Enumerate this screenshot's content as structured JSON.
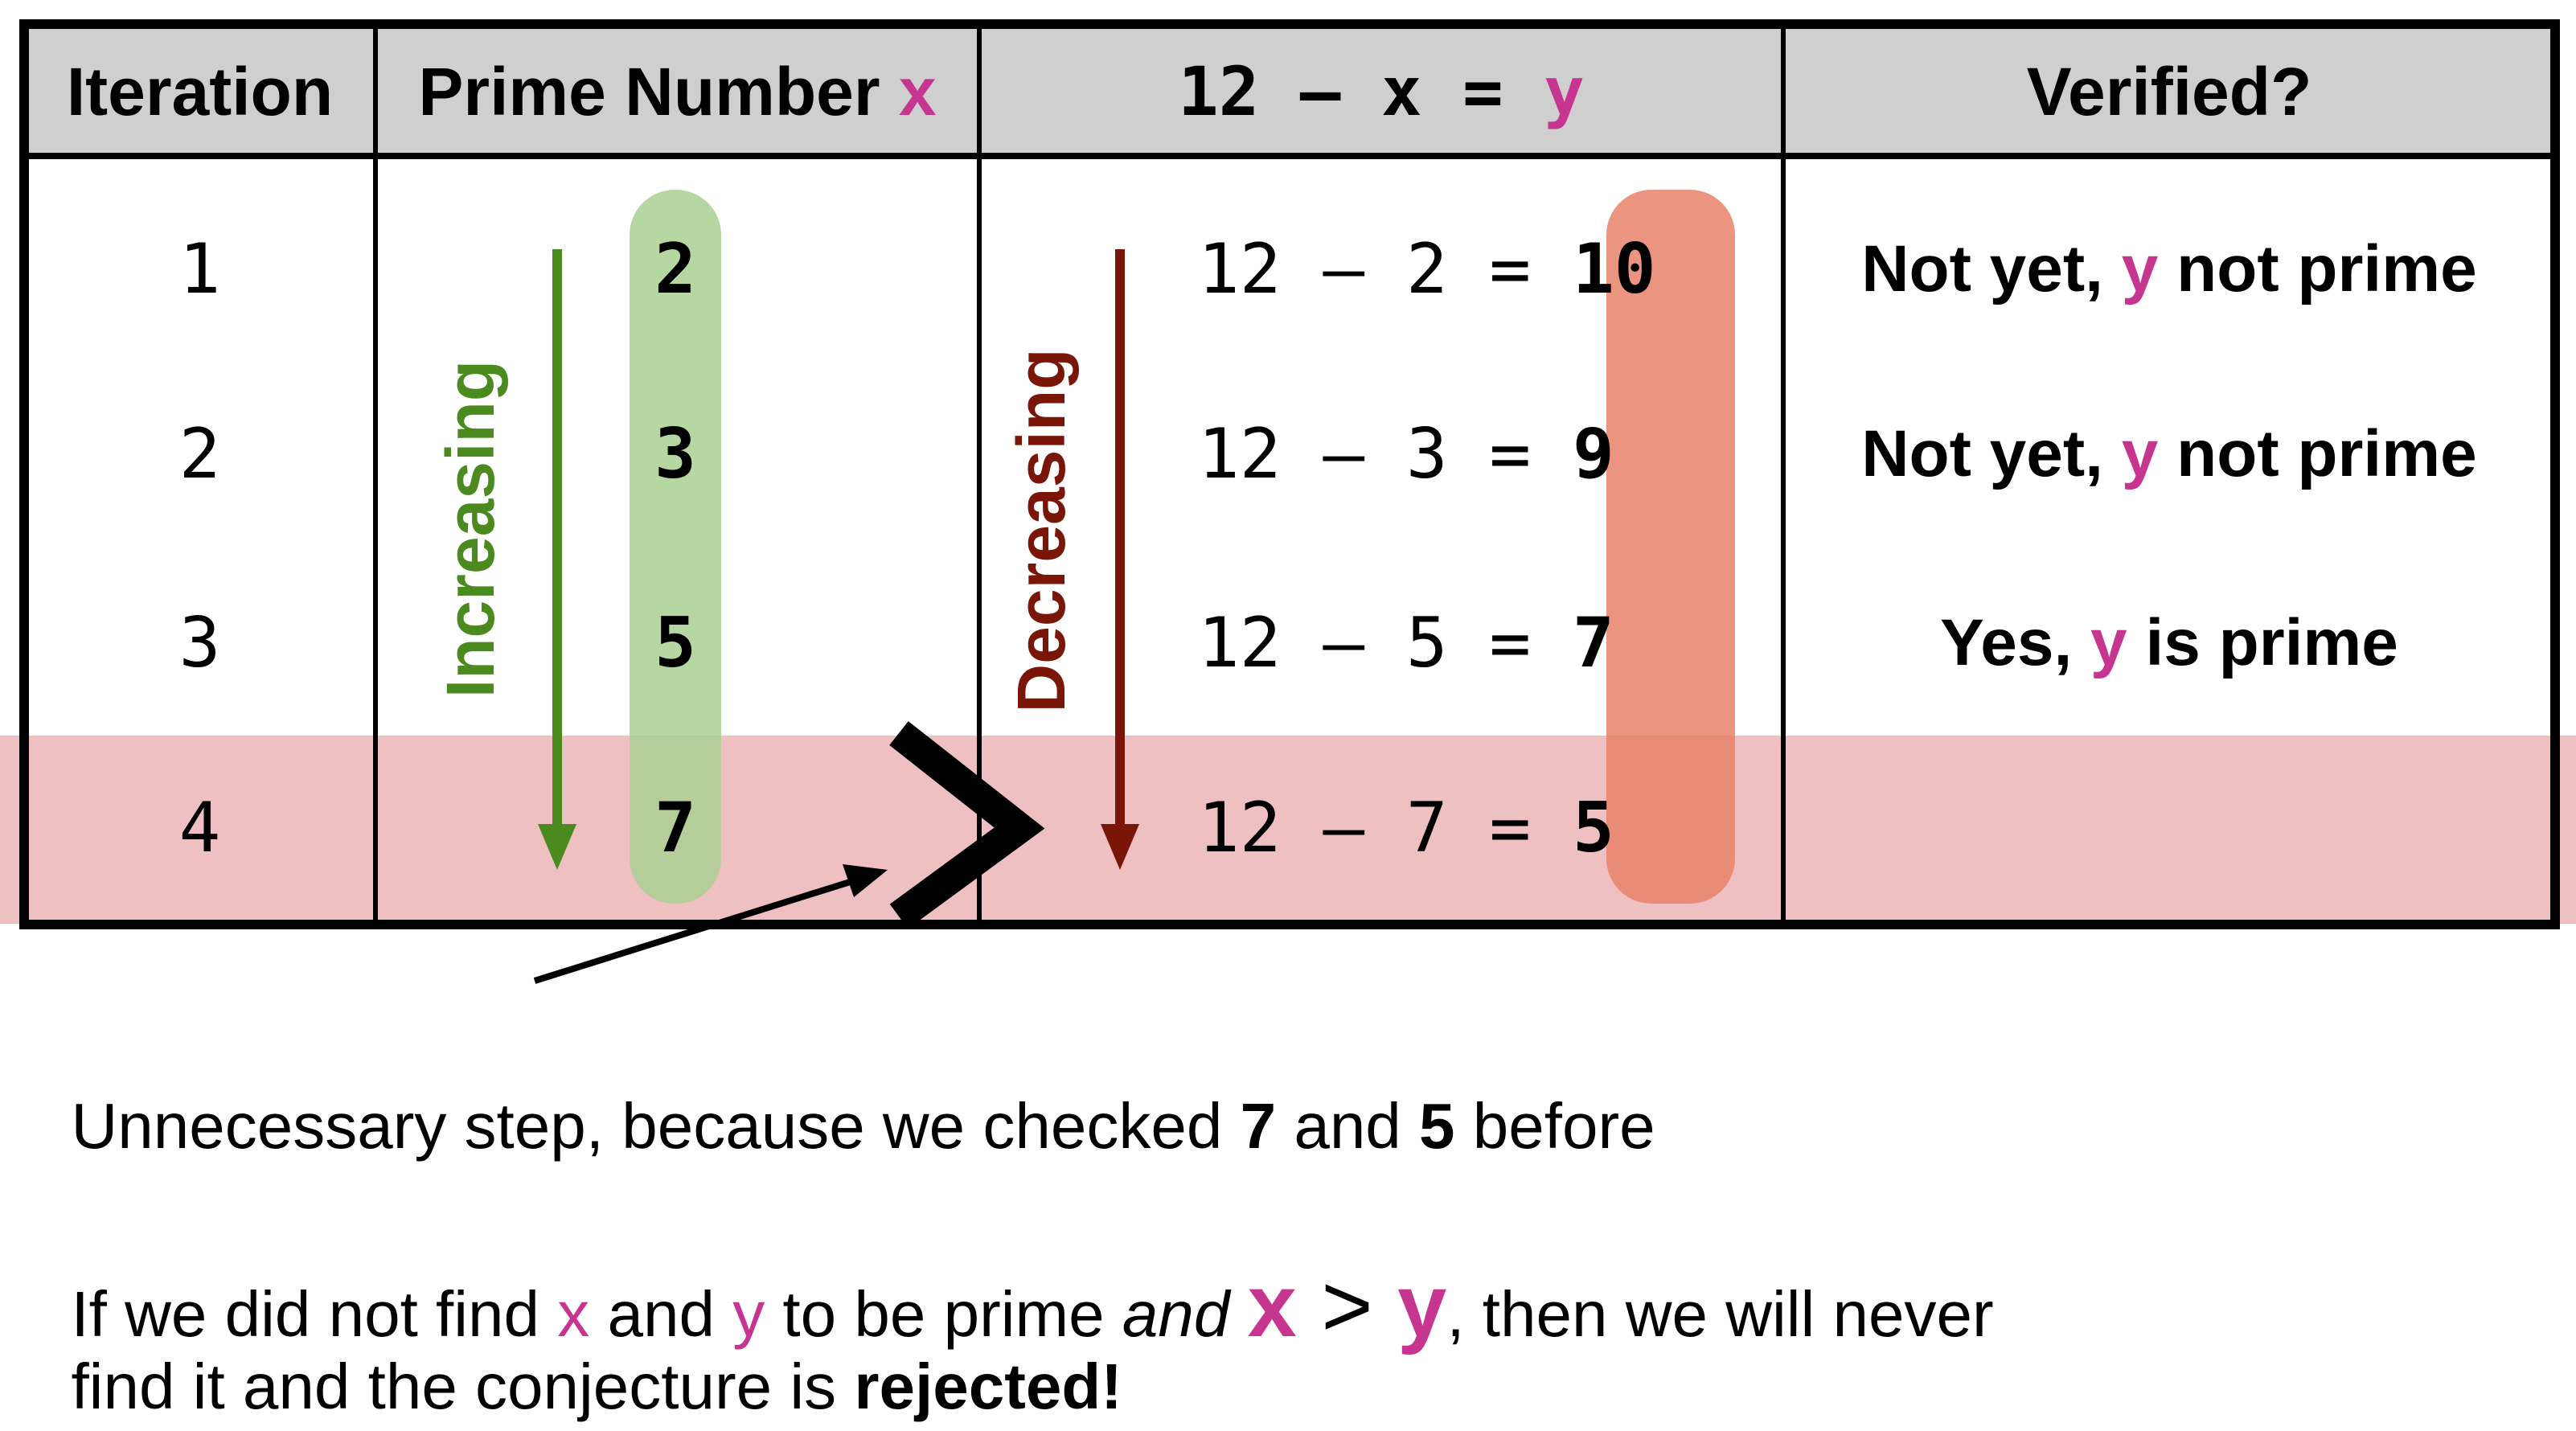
{
  "table": {
    "headers": {
      "iteration": "Iteration",
      "prime_prefix": "Prime Number ",
      "prime_var": "x",
      "eq_prefix": "12 – x = ",
      "eq_var": "y",
      "verified": "Verified?"
    },
    "rows": [
      {
        "iteration": "1",
        "x": "2",
        "eq": "12 – 2 = ",
        "y": "10",
        "verified_pre": "Not yet, ",
        "verified_var": "y",
        "verified_post": " not prime"
      },
      {
        "iteration": "2",
        "x": "3",
        "eq": "12 – 3 = ",
        "y": "9",
        "verified_pre": "Not yet, ",
        "verified_var": "y",
        "verified_post": " not prime"
      },
      {
        "iteration": "3",
        "x": "5",
        "eq": "12 – 5 = ",
        "y": "7",
        "verified_pre": "Yes, ",
        "verified_var": "y",
        "verified_post": " is prime"
      },
      {
        "iteration": "4",
        "x": "7",
        "eq": "12 – 7 = ",
        "y": "5",
        "verified_pre": "",
        "verified_var": "",
        "verified_post": ""
      }
    ]
  },
  "labels": {
    "increasing": "Increasing",
    "decreasing": "Decreasing",
    "greater_than": ">"
  },
  "notes": {
    "line1_a": "Unnecessary step, because we checked ",
    "line1_b": "7",
    "line1_c": " and ",
    "line1_d": "5",
    "line1_e": " before",
    "line2_a": "If we did not find ",
    "line2_x": "x",
    "line2_b": " and ",
    "line2_y": "y",
    "line2_c": " to be prime ",
    "line2_and": "and",
    "line2_sp": " ",
    "line2_bigx": "x",
    "line2_gt": " > ",
    "line2_bigy": "y",
    "line2_d": ", then we will never",
    "line3_a": "find it and the conjecture is ",
    "line3_b": "rejected!"
  },
  "colors": {
    "accent_pink": "#c6358f",
    "header_bg": "#cfcfcf",
    "highlight_row": "#efc0c2",
    "green_pill": "#a9cf92",
    "red_pill": "#e7826a",
    "green_arrow": "#4a8a1f",
    "red_arrow": "#7a1608"
  }
}
